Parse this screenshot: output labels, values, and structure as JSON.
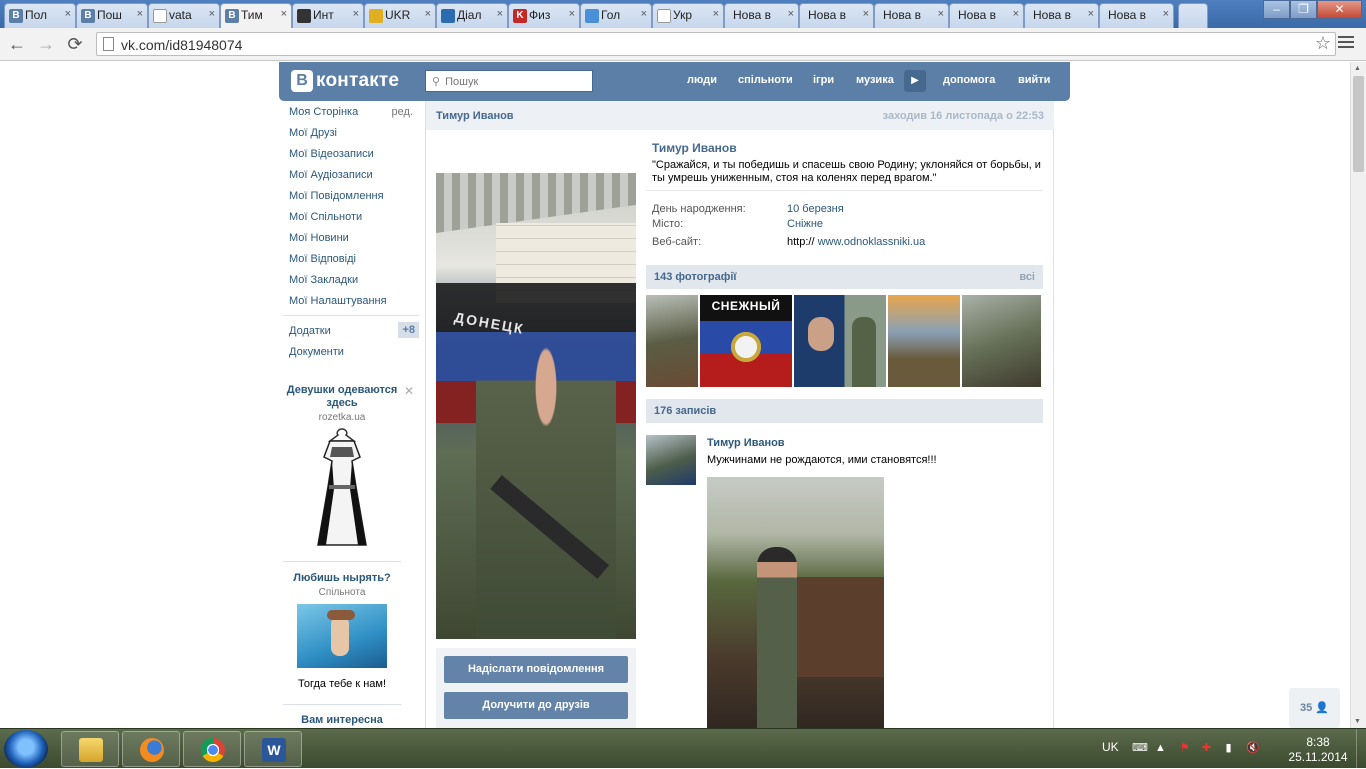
{
  "browser": {
    "tabs": [
      {
        "label": "Пол",
        "icon": "vk-icon",
        "color": "#5b7fa6"
      },
      {
        "label": "Пош",
        "icon": "vk-icon",
        "color": "#5b7fa6"
      },
      {
        "label": "vata",
        "icon": "page-icon",
        "color": "#ffffff"
      },
      {
        "label": "Тим",
        "icon": "vk-icon",
        "color": "#5b7fa6",
        "active": true
      },
      {
        "label": "Инт",
        "icon": "face-icon",
        "color": "#333333"
      },
      {
        "label": "UKR",
        "icon": "coin-icon",
        "color": "#e0b020"
      },
      {
        "label": "Діал",
        "icon": "chat-icon",
        "color": "#2b6cb0"
      },
      {
        "label": "Физ",
        "icon": "ki-icon",
        "color": "#c62828"
      },
      {
        "label": "Гол",
        "icon": "globe-icon",
        "color": "#4a90d9"
      },
      {
        "label": "Укр",
        "icon": "page-icon",
        "color": "#ffffff"
      },
      {
        "label": "Нова в",
        "icon": "",
        "color": ""
      },
      {
        "label": "Нова в",
        "icon": "",
        "color": ""
      },
      {
        "label": "Нова в",
        "icon": "",
        "color": ""
      },
      {
        "label": "Нова в",
        "icon": "",
        "color": ""
      },
      {
        "label": "Нова в",
        "icon": "",
        "color": ""
      },
      {
        "label": "Нова в",
        "icon": "",
        "color": ""
      }
    ],
    "url": "vk.com/id81948074"
  },
  "vk": {
    "logo_text": "контакте",
    "logo_letter": "В",
    "search_placeholder": "Пошук",
    "nav": [
      "люди",
      "спільноти",
      "ігри",
      "музика",
      "допомога",
      "вийти"
    ]
  },
  "left_menu": {
    "items": [
      "Моя Сторінка",
      "Мої Друзі",
      "Мої Відеозаписи",
      "Мої Аудіозаписи",
      "Мої Повідомлення",
      "Мої Спільноти",
      "Мої Новини",
      "Мої Відповіді",
      "Мої Закладки",
      "Мої Налаштування"
    ],
    "edit_label": "ред.",
    "extra_items": [
      "Додатки",
      "Документи"
    ],
    "apps_badge": "+8"
  },
  "ads": {
    "ad1_title": "Девушки одеваются здесь",
    "ad1_domain": "rozetka.ua",
    "ad2_title": "Любишь нырять?",
    "ad2_domain": "Спільнота",
    "ad2_sub": "Тогда тебе к нам!",
    "ad3_title": "Вам интересна"
  },
  "profile": {
    "header_name": "Тимур Иванов",
    "last_seen": "заходив 16 листопада о 22:53",
    "name": "Тимур Иванов",
    "status": "\"Сражайся, и ты победишь и спасешь свою Родину; уклоняйся от борьбы, и ты умрешь униженным, стоя на коленях перед врагом.\"",
    "birthday_label": "День народження:",
    "birthday": "10 березня",
    "city_label": "Місто:",
    "city": "Сніжне",
    "site_label": "Веб-сайт:",
    "site_prefix": "http://",
    "site": "www.odnoklassniki.ua",
    "send_message": "Надіслати повідомлення",
    "add_friend": "Долучити до друзів",
    "photos_title": "143 фотографії",
    "photos_all": "всі",
    "photo_thumb_label": "СНЕЖНЫЙ",
    "posts_title": "176 записів",
    "post_author": "Тимур Иванов",
    "post_text": "Мужчинами не рождаются, ими становятся!!!",
    "flag_text": "ДОНЕЦК"
  },
  "page": {
    "online_count": "35"
  },
  "taskbar": {
    "apps": [
      "explorer-icon",
      "firefox-icon",
      "chrome-icon",
      "word-icon"
    ],
    "language": "UK",
    "time": "8:38",
    "date": "25.11.2014"
  }
}
